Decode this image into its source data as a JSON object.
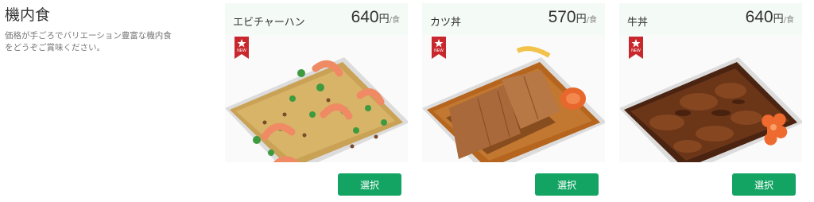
{
  "section": {
    "title": "機内食",
    "description_line1": "価格が手ごろでバリエーション豊富な機内食",
    "description_line2": "をどうぞご賞味ください。"
  },
  "badge_text": "NEW",
  "meals": [
    {
      "name": "エビチャーハン",
      "price": "640",
      "currency": "円",
      "per": "/食",
      "select_label": "選択"
    },
    {
      "name": "カツ丼",
      "price": "570",
      "currency": "円",
      "per": "/食",
      "select_label": "選択"
    },
    {
      "name": "牛丼",
      "price": "640",
      "currency": "円",
      "per": "/食",
      "select_label": "選択"
    }
  ],
  "colors": {
    "button": "#13a463",
    "badge": "#c8282d",
    "card_header": "#f4faf5"
  }
}
